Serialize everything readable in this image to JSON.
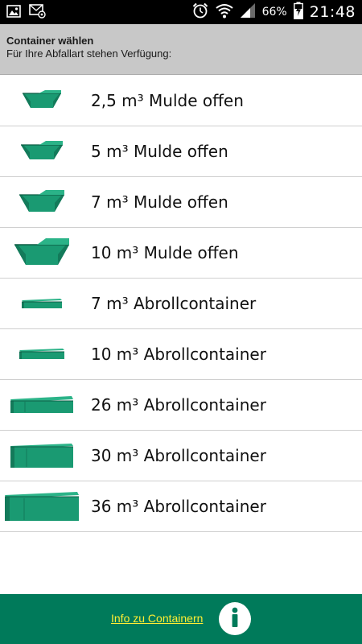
{
  "status_bar": {
    "battery_percent": "66%",
    "time": "21:48",
    "icons": [
      "image-icon",
      "mail-icon",
      "alarm-icon",
      "wifi-icon",
      "signal-icon",
      "battery-charging-icon"
    ]
  },
  "header": {
    "title": "Container wählen",
    "subtitle": "Für Ihre Abfallart stehen Verfügung:"
  },
  "containers": [
    {
      "label": "2,5 m³ Mulde offen",
      "icon": "skip-container-icon"
    },
    {
      "label": "5 m³ Mulde offen",
      "icon": "skip-container-icon"
    },
    {
      "label": "7 m³ Mulde offen",
      "icon": "skip-container-icon"
    },
    {
      "label": "10 m³ Mulde offen",
      "icon": "skip-container-icon"
    },
    {
      "label": "7 m³ Abrollcontainer",
      "icon": "roll-off-container-icon"
    },
    {
      "label": "10 m³ Abrollcontainer",
      "icon": "roll-off-container-icon"
    },
    {
      "label": "26 m³ Abrollcontainer",
      "icon": "roll-off-container-icon"
    },
    {
      "label": "30 m³ Abrollcontainer",
      "icon": "roll-off-container-icon"
    },
    {
      "label": "36 m³ Abrollcontainer",
      "icon": "roll-off-container-icon"
    }
  ],
  "footer": {
    "info_link": "Info zu Containern",
    "info_icon": "info-icon"
  },
  "colors": {
    "accent_green": "#007a5a",
    "container_green": "#1a9a72",
    "link_yellow": "#ffee33",
    "header_gray": "#c8c8c8"
  }
}
